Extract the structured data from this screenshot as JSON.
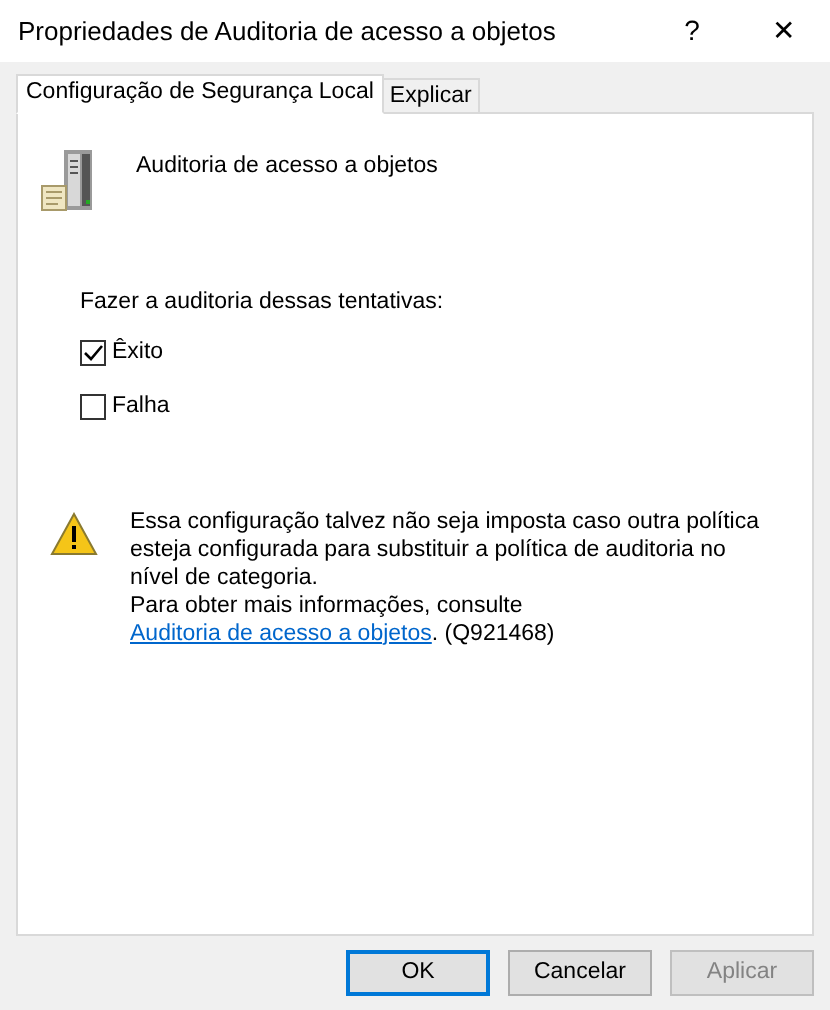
{
  "window": {
    "title": "Propriedades de Auditoria de acesso a objetos",
    "help": "?",
    "close": "✕"
  },
  "tabs": [
    {
      "label": "Configuração de Segurança Local",
      "selected": true
    },
    {
      "label": "Explicar",
      "selected": false
    }
  ],
  "policy_name": "Auditoria de acesso a objetos",
  "audit_label": "Fazer a auditoria dessas tentativas:",
  "options": [
    {
      "label": "Êxito",
      "checked": true
    },
    {
      "label": "Falha",
      "checked": false
    }
  ],
  "warning": {
    "text": "Essa configuração talvez não seja imposta caso outra política esteja configurada para substituir a política de auditoria no nível de categoria.",
    "info_prefix": "Para obter mais informações, consulte",
    "link": "Auditoria de acesso a objetos",
    "info_suffix": ". (Q921468)"
  },
  "buttons": [
    {
      "label": "OK",
      "kind": "default",
      "disabled": false
    },
    {
      "label": "Cancelar",
      "kind": "normal",
      "disabled": false
    },
    {
      "label": "Aplicar",
      "kind": "normal",
      "disabled": true
    }
  ]
}
